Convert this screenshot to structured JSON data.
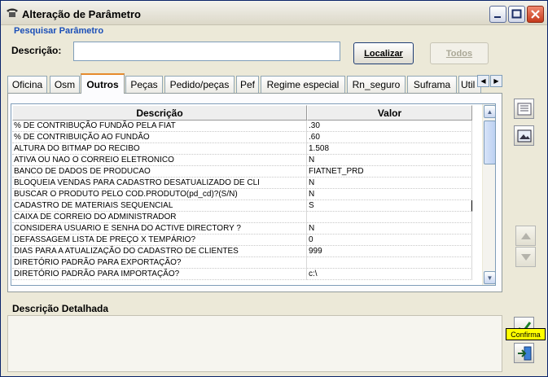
{
  "window": {
    "title": "Alteração de Parâmetro"
  },
  "search": {
    "section_title": "Pesquisar Parâmetro",
    "description_label": "Descrição:",
    "description_value": "",
    "find_button": "Localizar",
    "all_button": "Todos"
  },
  "tabs": [
    {
      "label": "Oficina"
    },
    {
      "label": "Osm"
    },
    {
      "label": "Outros"
    },
    {
      "label": "Peças"
    },
    {
      "label": "Pedido/peças"
    },
    {
      "label": "Pef"
    },
    {
      "label": "Regime especial"
    },
    {
      "label": "Rn_seguro"
    },
    {
      "label": "Suframa"
    },
    {
      "label": "Util"
    }
  ],
  "active_tab": "Outros",
  "grid": {
    "columns": [
      "Descrição",
      "Valor"
    ],
    "rows": [
      [
        "% DE CONTRIBUÇÃO FUNDÃO PELA FIAT",
        ".30"
      ],
      [
        "% DE CONTRIBUIÇÃO AO FUNDÃO",
        ".60"
      ],
      [
        "ALTURA DO BITMAP DO RECIBO",
        "1.508"
      ],
      [
        "ATIVA OU NAO O CORREIO ELETRONICO",
        "N"
      ],
      [
        "BANCO DE DADOS DE PRODUCAO",
        "FIATNET_PRD"
      ],
      [
        "BLOQUEIA VENDAS PARA CADASTRO DESATUALIZADO DE CLI",
        "N"
      ],
      [
        "BUSCAR O PRODUTO PELO COD.PRODUTO(pd_cd)?(S/N)",
        "N"
      ],
      [
        "CADASTRO DE MATERIAIS SEQUENCIAL",
        "S"
      ],
      [
        "CAIXA DE CORREIO DO ADMINISTRADOR",
        ""
      ],
      [
        "CONSIDERA USUARIO E SENHA DO ACTIVE DIRECTORY ?",
        "N"
      ],
      [
        "DEFASSAGEM LISTA DE PREÇO X TEMPÁRIO?",
        "0"
      ],
      [
        "DIAS PARA A ATUALIZAÇÃO DO CADASTRO DE CLIENTES",
        "999"
      ],
      [
        "DIRETÓRIO PADRÃO PARA EXPORTAÇÃO?",
        ""
      ],
      [
        "DIRETÓRIO PADRÃO PARA IMPORTAÇÃO?",
        "c:\\"
      ]
    ]
  },
  "detail": {
    "title": "Descrição Detalhada",
    "value": ""
  },
  "tooltip": {
    "text": "Confirma"
  },
  "colors": {
    "section_title": "#1b4fb8",
    "active_tab_accent": "#e68b2c",
    "tooltip_bg": "#ffff00"
  }
}
